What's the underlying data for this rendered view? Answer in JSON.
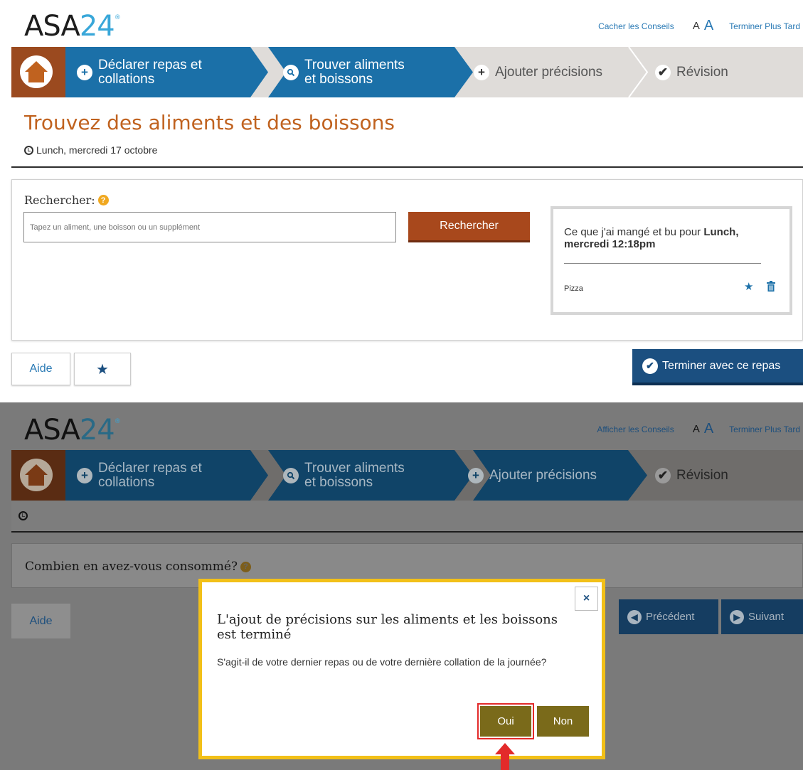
{
  "app": {
    "logo_text": "ASA",
    "logo_num": "24",
    "logo_mark": "®"
  },
  "screen1": {
    "top_links": {
      "tips": "Cacher les Conseils",
      "font_small": "A",
      "font_large": "A",
      "finish_later": "Terminer Plus Tard"
    },
    "steps": [
      {
        "icon": "plus-icon",
        "line1": "Déclarer repas et",
        "line2": "collations"
      },
      {
        "icon": "search-icon",
        "line1": "Trouver aliments",
        "line2": "et boissons"
      },
      {
        "icon": "plus-icon",
        "label": "Ajouter précisions"
      },
      {
        "icon": "check-icon",
        "label": "Révision"
      }
    ],
    "title": "Trouvez des aliments et des boissons",
    "meal": "Lunch, mercredi 17 octobre",
    "search": {
      "label": "Rechercher:",
      "placeholder": "Tapez un aliment, une boisson ou un supplément",
      "button": "Rechercher"
    },
    "eaten": {
      "head_prefix": "Ce que j'ai mangé et bu pour ",
      "head_bold": "Lunch, mercredi 12:18pm",
      "items": [
        {
          "name": "Pizza"
        }
      ]
    },
    "help_button": "Aide",
    "favorite_button": "★",
    "finish_button": "Terminer avec ce repas"
  },
  "screen2": {
    "top_links": {
      "tips": "Afficher les Conseils",
      "font_small": "A",
      "font_large": "A",
      "finish_later": "Terminer Plus Tard"
    },
    "steps": [
      {
        "line1": "Déclarer repas et",
        "line2": "collations"
      },
      {
        "line1": "Trouver aliments",
        "line2": "et boissons"
      },
      {
        "label": "Ajouter précisions"
      },
      {
        "label": "Révision"
      }
    ],
    "question": "Combien en avez-vous consommé?",
    "help_button": "Aide",
    "prev_button": "Précédent",
    "next_button": "Suivant",
    "modal": {
      "close": "×",
      "title": "L'ajout de précisions sur les aliments et les boissons est terminé",
      "body": "S'agit-il de votre dernier repas ou de votre dernière collation de la journée?",
      "yes": "Oui",
      "no": "Non"
    }
  },
  "colors": {
    "brand_blue": "#1b70a8",
    "home_brown": "#9b4a1f",
    "title_orange": "#c0621f",
    "modal_border": "#f2c018",
    "highlight_red": "#e32a2a"
  }
}
